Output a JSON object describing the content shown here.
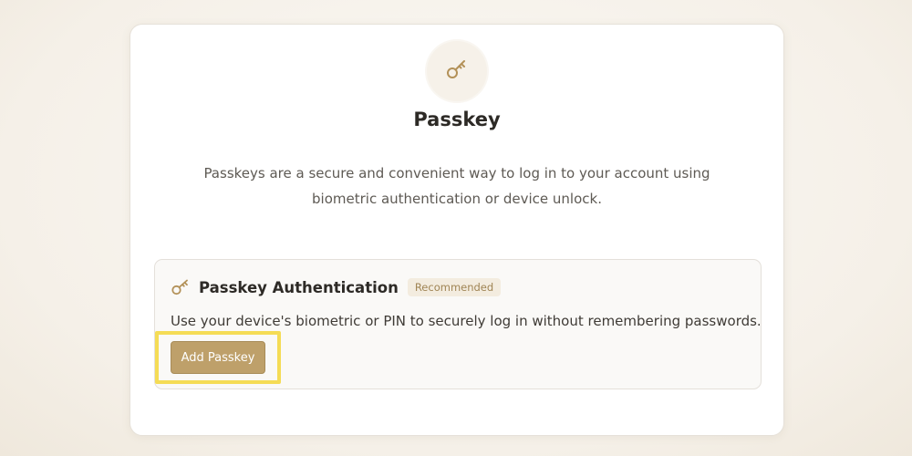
{
  "page": {
    "title": "Passkey",
    "description": "Passkeys are a secure and convenient way to log in to your account using biometric authentication or device unlock."
  },
  "auth_option": {
    "title": "Passkey Authentication",
    "badge": "Recommended",
    "description": "Use your device's biometric or PIN to securely log in without remembering passwords.",
    "button_label": "Add Passkey"
  },
  "icons": {
    "header": "key-icon",
    "panel": "key-icon"
  },
  "colors": {
    "accent": "#bea06a",
    "badge_bg": "#f3ecdf",
    "badge_text": "#a08555",
    "highlight": "#f5dc55"
  }
}
